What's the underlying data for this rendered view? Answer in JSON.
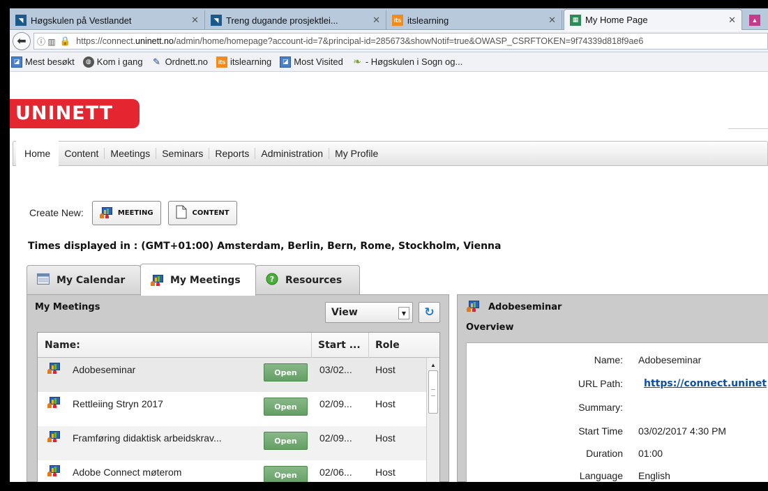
{
  "browser": {
    "tabs": [
      {
        "title": "Høgskulen på Vestlandet",
        "icon": "hvl-favicon"
      },
      {
        "title": "Treng dugande prosjektlei...",
        "icon": "hvl-favicon"
      },
      {
        "title": "itslearning",
        "icon": "itslearning-favicon"
      },
      {
        "title": "My Home Page",
        "icon": "adobe-connect-favicon",
        "active": true
      }
    ],
    "url": {
      "prefix": "https://connect.",
      "host": "uninett.no",
      "path": "/admin/home/homepage?account-id=7&principal-id=285673&showNotif=true&OWASP_CSRFTOKEN=9f74339d818f9ae6"
    },
    "bookmarks": [
      {
        "label": "Mest besøkt",
        "icon": "bookmark-page-icon"
      },
      {
        "label": "Kom i gang",
        "icon": "globe-icon"
      },
      {
        "label": "Ordnett.no",
        "icon": "ordnett-icon"
      },
      {
        "label": "itslearning",
        "icon": "itslearning-icon"
      },
      {
        "label": "Most Visited",
        "icon": "bookmark-page-icon"
      },
      {
        "label": "- Høgskulen i Sogn og...",
        "icon": "leaf-icon"
      }
    ]
  },
  "logo": "UNINETT",
  "menu": [
    "Home",
    "Content",
    "Meetings",
    "Seminars",
    "Reports",
    "Administration",
    "My Profile"
  ],
  "create": {
    "label": "Create New:",
    "meeting": "MEETING",
    "content": "CONTENT"
  },
  "timezone": "Times displayed in : (GMT+01:00) Amsterdam, Berlin, Bern, Rome, Stockholm, Vienna",
  "content_tabs": [
    {
      "label": "My Calendar",
      "icon": "calendar-icon"
    },
    {
      "label": "My Meetings",
      "icon": "meeting-icon",
      "active": true
    },
    {
      "label": "Resources",
      "icon": "help-icon"
    }
  ],
  "meetings_panel": {
    "title": "My Meetings",
    "view_select": "View",
    "columns": [
      "Name:",
      "Start ...",
      "Role"
    ],
    "open_label": "Open",
    "rows": [
      {
        "name": "Adobeseminar",
        "start": "03/02...",
        "role": "Host"
      },
      {
        "name": "Rettleiing Stryn 2017",
        "start": "02/09...",
        "role": "Host"
      },
      {
        "name": "Framføring didaktisk arbeidskrav...",
        "start": "02/09...",
        "role": "Host"
      },
      {
        "name": "Adobe Connect møterom",
        "start": "02/06...",
        "role": "Host"
      }
    ]
  },
  "detail_panel": {
    "title": "Adobeseminar",
    "overview": "Overview",
    "fields": [
      {
        "key": "Name:",
        "value": "Adobeseminar"
      },
      {
        "key": "URL Path:",
        "value": "https://connect.uninet",
        "link": true
      },
      {
        "key": "Summary:",
        "value": ""
      },
      {
        "key": "Start Time",
        "value": "03/02/2017 4:30 PM"
      },
      {
        "key": "Duration",
        "value": "01:00"
      },
      {
        "key": "Language",
        "value": "English"
      }
    ]
  },
  "colors": {
    "brand_red": "#e3262f",
    "open_button": "#6aa66a",
    "link": "#0a4fa8"
  }
}
